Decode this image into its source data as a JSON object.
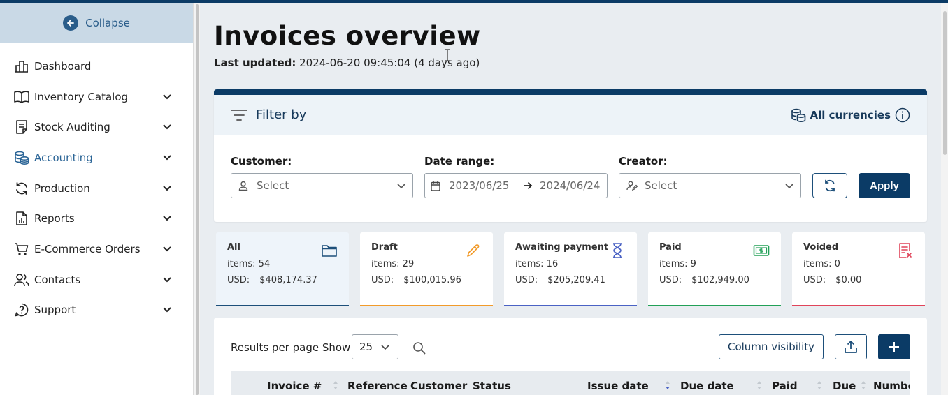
{
  "sidebar": {
    "collapse_label": "Collapse",
    "items": [
      {
        "label": "Dashboard",
        "icon": "dashboard-icon",
        "has_submenu": false
      },
      {
        "label": "Inventory Catalog",
        "icon": "book-icon",
        "has_submenu": true
      },
      {
        "label": "Stock Auditing",
        "icon": "clipboard-icon",
        "has_submenu": true
      },
      {
        "label": "Accounting",
        "icon": "coins-icon",
        "has_submenu": true,
        "active": true
      },
      {
        "label": "Production",
        "icon": "sync-icon",
        "has_submenu": true
      },
      {
        "label": "Reports",
        "icon": "report-icon",
        "has_submenu": true
      },
      {
        "label": "E-Commerce Orders",
        "icon": "cart-icon",
        "has_submenu": true
      },
      {
        "label": "Contacts",
        "icon": "contacts-icon",
        "has_submenu": true
      },
      {
        "label": "Support",
        "icon": "support-icon",
        "has_submenu": true
      }
    ]
  },
  "page": {
    "title": "Invoices overview",
    "last_updated_label": "Last updated:",
    "last_updated_value": "2024-06-20 09:45:04 (4 days ago)"
  },
  "filter": {
    "title": "Filter by",
    "currency_label": "All currencies",
    "customer_label": "Customer:",
    "customer_placeholder": "Select",
    "date_label": "Date range:",
    "date_from": "2023/06/25",
    "date_to": "2024/06/24",
    "creator_label": "Creator:",
    "creator_placeholder": "Select",
    "apply_label": "Apply"
  },
  "statuses": [
    {
      "name": "All",
      "items_label": "items:",
      "items": "54",
      "currency": "USD:",
      "amount": "$408,174.37",
      "color": "#1d4f7a",
      "icon": "folder-icon"
    },
    {
      "name": "Draft",
      "items_label": "items:",
      "items": "29",
      "currency": "USD:",
      "amount": "$100,015.96",
      "color": "#f29b2b",
      "icon": "pencil-icon"
    },
    {
      "name": "Awaiting payment",
      "items_label": "items:",
      "items": "16",
      "currency": "USD:",
      "amount": "$205,209.41",
      "color": "#4a62c4",
      "icon": "hourglass-icon"
    },
    {
      "name": "Paid",
      "items_label": "items:",
      "items": "9",
      "currency": "USD:",
      "amount": "$102,949.00",
      "color": "#22a057",
      "icon": "cash-icon"
    },
    {
      "name": "Voided",
      "items_label": "items:",
      "items": "0",
      "currency": "USD:",
      "amount": "$0.00",
      "color": "#e0445a",
      "icon": "void-receipt-icon"
    }
  ],
  "results": {
    "per_page_label": "Results per page Show",
    "per_page_value": "25",
    "column_visibility_label": "Column visibility"
  },
  "table": {
    "columns": [
      "Invoice #",
      "Reference",
      "Customer",
      "Status",
      "Issue date",
      "Due date",
      "Paid",
      "Due",
      "Numbe"
    ]
  }
}
